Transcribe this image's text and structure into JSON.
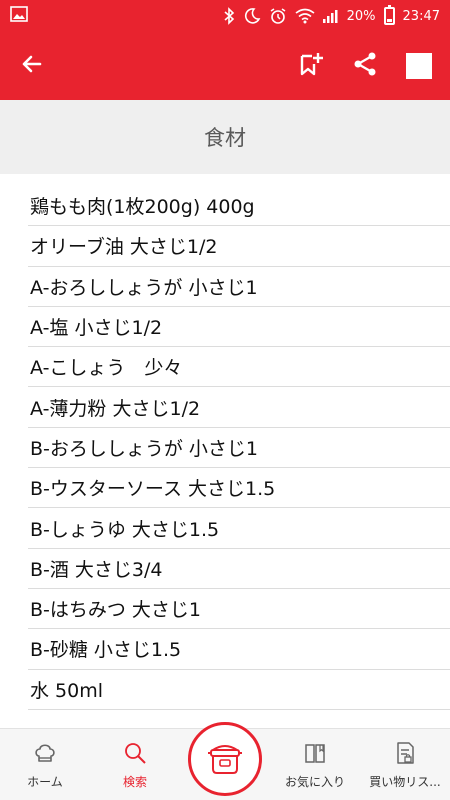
{
  "status_bar": {
    "battery_percent": "20%",
    "time": "23:47"
  },
  "app_bar": {
    "icons": [
      "back-arrow-icon",
      "bookmark-add-icon",
      "share-icon",
      "square-icon"
    ]
  },
  "section": {
    "title": "食材"
  },
  "ingredients": [
    "鶏もも肉(1枚200g) 400g",
    "オリーブ油 大さじ1/2",
    "A-おろししょうが 小さじ1",
    "A-塩 小さじ1/2",
    "A-こしょう　少々",
    "A-薄力粉 大さじ1/2",
    "B-おろししょうが 小さじ1",
    "B-ウスターソース 大さじ1.5",
    "B-しょうゆ 大さじ1.5",
    "B-酒 大さじ3/4",
    "B-はちみつ 大さじ1",
    "B-砂糖 小さじ1.5",
    "水 50ml"
  ],
  "bottom_nav": {
    "home": "ホーム",
    "search": "検索",
    "favorites": "お気に入り",
    "shopping_list": "買い物リス..."
  },
  "colors": {
    "brand_red": "#e8232f",
    "header_gray": "#efefef"
  }
}
